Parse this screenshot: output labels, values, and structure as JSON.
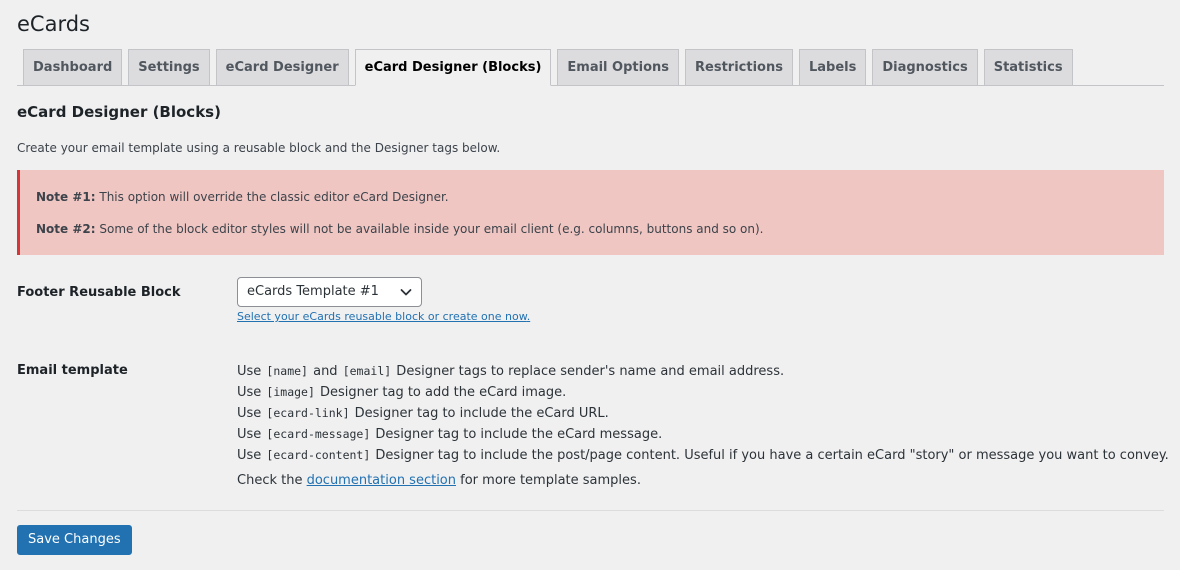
{
  "app": {
    "title": "eCards"
  },
  "tabs": [
    {
      "label": "Dashboard",
      "active": false
    },
    {
      "label": "Settings",
      "active": false
    },
    {
      "label": "eCard Designer",
      "active": false
    },
    {
      "label": "eCard Designer (Blocks)",
      "active": true
    },
    {
      "label": "Email Options",
      "active": false
    },
    {
      "label": "Restrictions",
      "active": false
    },
    {
      "label": "Labels",
      "active": false
    },
    {
      "label": "Diagnostics",
      "active": false
    },
    {
      "label": "Statistics",
      "active": false
    }
  ],
  "page": {
    "title": "eCard Designer (Blocks)",
    "intro": "Create your email template using a reusable block and the Designer tags below."
  },
  "notice": {
    "note1_label": "Note #1:",
    "note1_text": " This option will override the classic editor eCard Designer.",
    "note2_label": "Note #2:",
    "note2_text": " Some of the block editor styles will not be available inside your email client (e.g. columns, buttons and so on).",
    "border_color": "#d63638",
    "bg_color": "#f0c6c3"
  },
  "footer_block": {
    "label": "Footer Reusable Block",
    "selected": "eCards Template #1",
    "help_link": "Select your eCards reusable block or create one now",
    "help_tail": "."
  },
  "email_template": {
    "label": "Email template",
    "lines": [
      {
        "pre": "Use ",
        "tag1": "[name]",
        "mid": " and ",
        "tag2": "[email]",
        "post": " Designer tags to replace sender's name and email address."
      },
      {
        "pre": "Use ",
        "tag": "[image]",
        "post": " Designer tag to add the eCard image."
      },
      {
        "pre": "Use ",
        "tag": "[ecard-link]",
        "post": " Designer tag to include the eCard URL."
      },
      {
        "pre": "Use ",
        "tag": "[ecard-message]",
        "post": " Designer tag to include the eCard message."
      },
      {
        "pre": "Use ",
        "tag": "[ecard-content]",
        "post": " Designer tag to include the post/page content. Useful if you have a certain eCard \"story\" or message you want to convey."
      }
    ],
    "check_pre": "Check the ",
    "check_link": "documentation section",
    "check_post": " for more template samples."
  },
  "actions": {
    "save_label": "Save Changes",
    "accent": "#2271b1"
  },
  "icons": {
    "select_chevron": "chevron-down-icon"
  }
}
